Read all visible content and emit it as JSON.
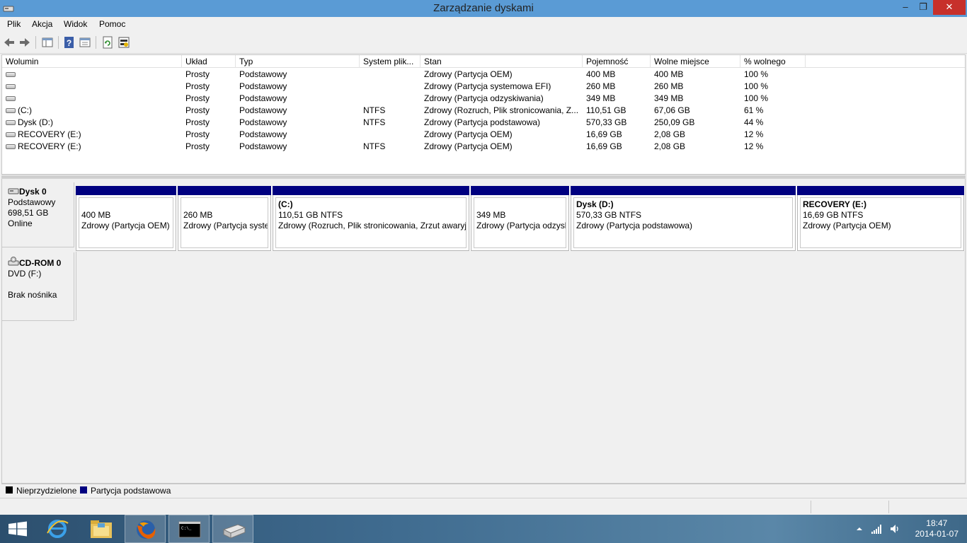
{
  "window": {
    "title": "Zarządzanie dyskami",
    "minimize": "–",
    "maximize": "❐",
    "close": "✕"
  },
  "menu": [
    "Plik",
    "Akcja",
    "Widok",
    "Pomoc"
  ],
  "volumes": {
    "columns": [
      "Wolumin",
      "Układ",
      "Typ",
      "System plik...",
      "Stan",
      "Pojemność",
      "Wolne miejsce",
      "% wolnego"
    ],
    "rows": [
      [
        "",
        "Prosty",
        "Podstawowy",
        "",
        "Zdrowy (Partycja OEM)",
        "400 MB",
        "400 MB",
        "100 %"
      ],
      [
        "",
        "Prosty",
        "Podstawowy",
        "",
        "Zdrowy (Partycja systemowa EFI)",
        "260 MB",
        "260 MB",
        "100 %"
      ],
      [
        "",
        "Prosty",
        "Podstawowy",
        "",
        "Zdrowy (Partycja odzyskiwania)",
        "349 MB",
        "349 MB",
        "100 %"
      ],
      [
        "(C:)",
        "Prosty",
        "Podstawowy",
        "NTFS",
        "Zdrowy (Rozruch, Plik stronicowania, Z...",
        "110,51 GB",
        "67,06 GB",
        "61 %"
      ],
      [
        "Dysk (D:)",
        "Prosty",
        "Podstawowy",
        "NTFS",
        "Zdrowy (Partycja podstawowa)",
        "570,33 GB",
        "250,09 GB",
        "44 %"
      ],
      [
        "RECOVERY (E:)",
        "Prosty",
        "Podstawowy",
        "",
        "Zdrowy (Partycja OEM)",
        "16,69 GB",
        "2,08 GB",
        "12 %"
      ],
      [
        "RECOVERY (E:)",
        "Prosty",
        "Podstawowy",
        "NTFS",
        "Zdrowy (Partycja OEM)",
        "16,69 GB",
        "2,08 GB",
        "12 %"
      ]
    ]
  },
  "disk0": {
    "name": "Dysk 0",
    "type": "Podstawowy",
    "size": "698,51 GB",
    "status": "Online",
    "partitions": [
      {
        "title": "",
        "size": "400 MB",
        "status": "Zdrowy (Partycja OEM)"
      },
      {
        "title": "",
        "size": "260 MB",
        "status": "Zdrowy (Partycja syste"
      },
      {
        "title": "(C:)",
        "size": "110,51 GB NTFS",
        "status": "Zdrowy (Rozruch, Plik stronicowania, Zrzut awaryj"
      },
      {
        "title": "",
        "size": "349 MB",
        "status": "Zdrowy (Partycja odzysk"
      },
      {
        "title": "Dysk  (D:)",
        "size": "570,33 GB NTFS",
        "status": "Zdrowy (Partycja podstawowa)"
      },
      {
        "title": "RECOVERY  (E:)",
        "size": "16,69 GB NTFS",
        "status": "Zdrowy (Partycja OEM)"
      }
    ]
  },
  "cdrom0": {
    "name": "CD-ROM 0",
    "drive": "DVD (F:)",
    "status": "Brak nośnika"
  },
  "legend": [
    {
      "label": "Nieprzydzielone",
      "color": "#000000"
    },
    {
      "label": "Partycja podstawowa",
      "color": "#000080"
    }
  ],
  "taskbar": {
    "items": [
      "start-icon",
      "internet-explorer-icon",
      "file-explorer-icon",
      "firefox-icon",
      "command-prompt-icon",
      "disk-management-icon"
    ],
    "time": "18:47",
    "date": "2014-01-07"
  }
}
